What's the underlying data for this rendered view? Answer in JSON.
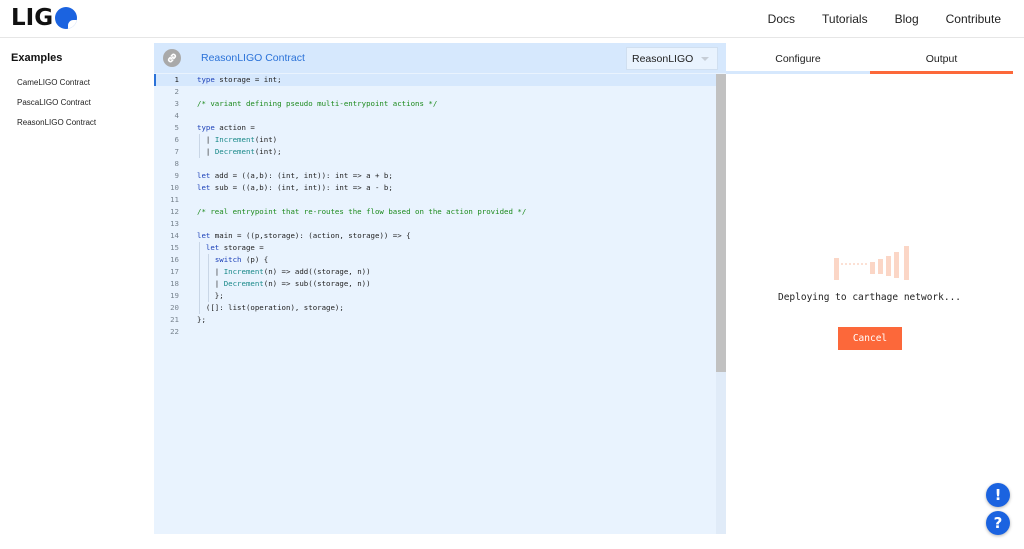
{
  "header": {
    "logo_text": "LIG",
    "nav": [
      "Docs",
      "Tutorials",
      "Blog",
      "Contribute"
    ]
  },
  "sidebar": {
    "title": "Examples",
    "items": [
      "CameLIGO Contract",
      "PascaLIGO Contract",
      "ReasonLIGO Contract"
    ]
  },
  "editor": {
    "title": "ReasonLIGO Contract",
    "language": "ReasonLIGO",
    "active_line": 1,
    "lines": [
      "type storage = int;",
      "",
      "/* variant defining pseudo multi-entrypoint actions */",
      "",
      "type action =",
      "  | Increment(int)",
      "  | Decrement(int);",
      "",
      "let add = ((a,b): (int, int)): int => a + b;",
      "let sub = ((a,b): (int, int)): int => a - b;",
      "",
      "/* real entrypoint that re-routes the flow based on the action provided */",
      "",
      "let main = ((p,storage): (action, storage)) => {",
      "  let storage =",
      "    switch (p) {",
      "    | Increment(n) => add((storage, n))",
      "    | Decrement(n) => sub((storage, n))",
      "    };",
      "  ([]: list(operation), storage);",
      "};",
      ""
    ]
  },
  "output": {
    "tabs": [
      "Configure",
      "Output"
    ],
    "active_tab": "Output",
    "status": "Deploying to carthage network...",
    "cancel_label": "Cancel"
  },
  "floating": {
    "alert_label": "!",
    "help_label": "?"
  },
  "colors": {
    "accent": "#fc683a",
    "brand_blue": "#1b63e0",
    "editor_bg": "#e9f3fe",
    "link_blue": "#2b72d8"
  }
}
